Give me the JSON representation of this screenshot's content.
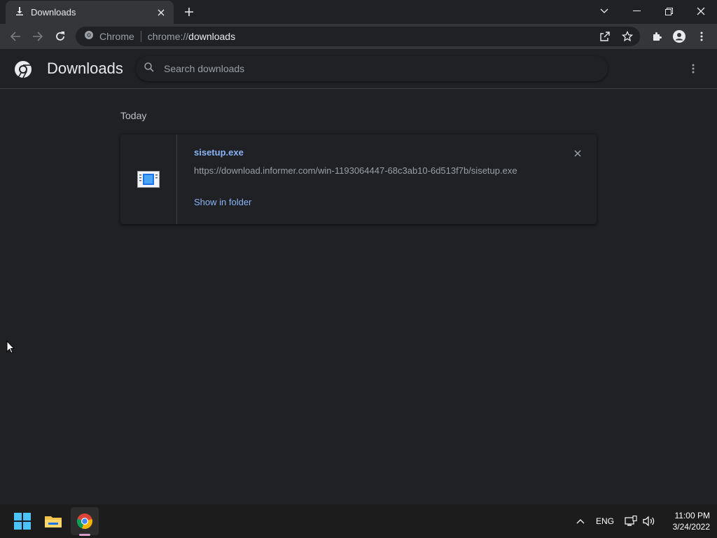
{
  "tab": {
    "title": "Downloads"
  },
  "omnibox": {
    "origin": "Chrome",
    "url_scheme": "chrome://",
    "url_host": "downloads"
  },
  "page": {
    "title": "Downloads",
    "search_placeholder": "Search downloads"
  },
  "downloads": {
    "date_group": "Today",
    "items": [
      {
        "file_name": "sisetup.exe",
        "url": "https://download.informer.com/win-1193064447-68c3ab10-6d513f7b/sisetup.exe",
        "action_label": "Show in folder"
      }
    ]
  },
  "taskbar": {
    "apps": [
      "start-icon",
      "file-explorer-icon",
      "chrome-icon"
    ],
    "language": "ENG",
    "time": "11:00 PM",
    "date": "3/24/2022"
  },
  "colors": {
    "accent": "#8ab4f8",
    "background": "#202124",
    "toolbar": "#35363a"
  }
}
